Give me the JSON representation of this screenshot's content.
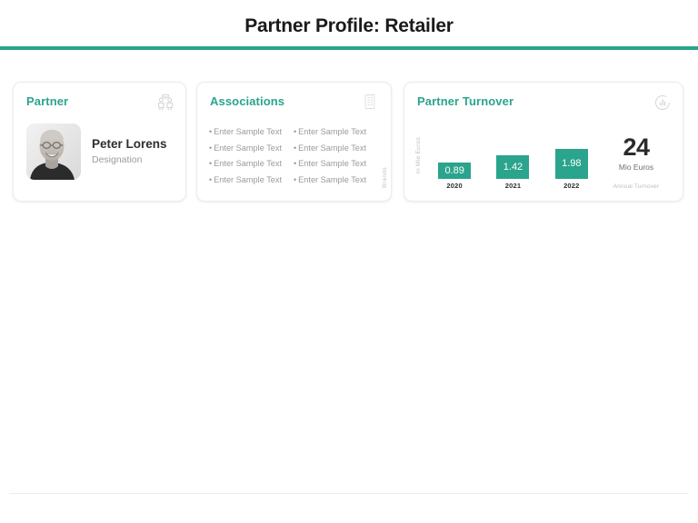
{
  "header": {
    "title": "Partner Profile: Retailer",
    "rule_color": "#2aa48c"
  },
  "cards": {
    "partner": {
      "title": "Partner",
      "icon": "two-people-icon",
      "person": {
        "name": "Peter Lorens",
        "designation": "Designation",
        "photo_alt": "portrait-photo"
      }
    },
    "associations": {
      "title": "Associations",
      "icon": "building-icon",
      "side_label": "Brands",
      "items": [
        "Enter Sample Text",
        "Enter Sample Text",
        "Enter Sample Text",
        "Enter Sample Text",
        "Enter Sample Text",
        "Enter Sample Text",
        "Enter Sample Text",
        "Enter Sample Text"
      ]
    },
    "turnover": {
      "title": "Partner Turnover",
      "icon": "bar-chart-circle-icon",
      "kpi": {
        "value": "24",
        "unit": "Mio Euros",
        "caption": "Annual Turnover"
      }
    }
  },
  "chart_data": {
    "type": "bar",
    "title": "Partner Turnover",
    "categories": [
      "2020",
      "2021",
      "2022"
    ],
    "values": [
      0.89,
      1.42,
      1.98
    ],
    "labels": [
      "0.89",
      "1.42",
      "1.98"
    ],
    "xlabel": "",
    "ylabel": "In Mio Euros",
    "ylim": [
      0,
      2.2
    ],
    "grid": false,
    "legend": false,
    "bar_color": "#2aa48c",
    "value_label_color": "#ffffff"
  }
}
